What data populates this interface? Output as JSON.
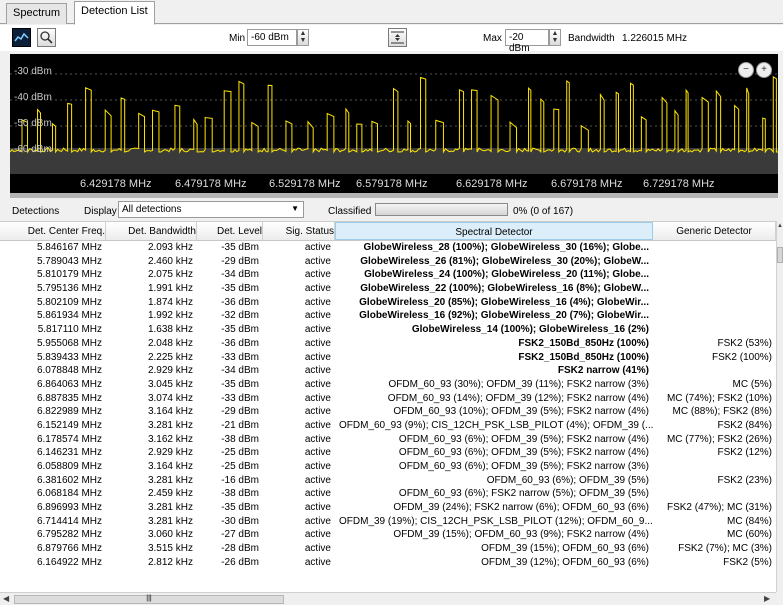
{
  "tabs": [
    {
      "label": "Spectrum",
      "active": false
    },
    {
      "label": "Detection List",
      "active": true
    }
  ],
  "toolbar": {
    "min_label": "Min",
    "min_value": "-60 dBm",
    "max_label": "Max",
    "max_value": "-20 dBm",
    "bandwidth_label": "Bandwidth",
    "bandwidth_value": "1.226015 MHz"
  },
  "spectrum": {
    "level_labels": [
      "-30 dBm",
      "-40 dBm",
      "-50 dBm",
      "-60 dBm"
    ],
    "freq_ticks": [
      "6.429178 MHz",
      "6.479178 MHz",
      "6.529178 MHz",
      "6.579178 MHz",
      "6.629178 MHz",
      "6.679178 MHz",
      "6.729178 MHz"
    ],
    "trace_color": "#ffe600",
    "background": "#000000"
  },
  "detections": {
    "label": "Detections",
    "display_label": "Display",
    "display_value": "All detections",
    "classified_label": "Classified",
    "classified_text": "0% (0 of 167)",
    "classified_fraction": 0
  },
  "table": {
    "columns": [
      "Det. Center Freq.",
      "Det. Bandwidth",
      "Det. Level",
      "Sig. Status",
      "Spectral Detector",
      "Generic Detector"
    ],
    "rows": [
      [
        "5.846167 MHz",
        "2.093 kHz",
        "-35 dBm",
        "active",
        "GlobeWireless_28 (100%); GlobeWireless_30 (16%); Globe...",
        "",
        true
      ],
      [
        "5.789043 MHz",
        "2.460 kHz",
        "-29 dBm",
        "active",
        "GlobeWireless_26 (81%); GlobeWireless_30 (20%); GlobeW...",
        "",
        true
      ],
      [
        "5.810179 MHz",
        "2.075 kHz",
        "-34 dBm",
        "active",
        "GlobeWireless_24 (100%); GlobeWireless_20 (11%); Globe...",
        "",
        true
      ],
      [
        "5.795136 MHz",
        "1.991 kHz",
        "-35 dBm",
        "active",
        "GlobeWireless_22 (100%); GlobeWireless_16 (8%); GlobeW...",
        "",
        true
      ],
      [
        "5.802109 MHz",
        "1.874 kHz",
        "-36 dBm",
        "active",
        "GlobeWireless_20 (85%); GlobeWireless_16 (4%); GlobeWir...",
        "",
        true
      ],
      [
        "5.861934 MHz",
        "1.992 kHz",
        "-32 dBm",
        "active",
        "GlobeWireless_16 (92%); GlobeWireless_20 (7%); GlobeWir...",
        "",
        true
      ],
      [
        "5.817110 MHz",
        "1.638 kHz",
        "-35 dBm",
        "active",
        "GlobeWireless_14 (100%); GlobeWireless_16 (2%)",
        "",
        true
      ],
      [
        "5.955068 MHz",
        "2.048 kHz",
        "-36 dBm",
        "active",
        "FSK2_150Bd_850Hz (100%)",
        "FSK2 (53%)",
        true
      ],
      [
        "5.839433 MHz",
        "2.225 kHz",
        "-33 dBm",
        "active",
        "FSK2_150Bd_850Hz (100%)",
        "FSK2 (100%)",
        true
      ],
      [
        "6.078848 MHz",
        "2.929 kHz",
        "-34 dBm",
        "active",
        "FSK2 narrow (41%)",
        "",
        true
      ],
      [
        "6.864063 MHz",
        "3.045 kHz",
        "-35 dBm",
        "active",
        "OFDM_60_93 (30%); OFDM_39 (11%); FSK2 narrow (3%)",
        "MC (5%)",
        false
      ],
      [
        "6.887835 MHz",
        "3.074 kHz",
        "-33 dBm",
        "active",
        "OFDM_60_93 (14%); OFDM_39 (12%); FSK2 narrow (4%)",
        "MC (74%); FSK2 (10%)",
        false
      ],
      [
        "6.822989 MHz",
        "3.164 kHz",
        "-29 dBm",
        "active",
        "OFDM_60_93 (10%); OFDM_39 (5%); FSK2 narrow (4%)",
        "MC (88%); FSK2 (8%)",
        false
      ],
      [
        "6.152149 MHz",
        "3.281 kHz",
        "-21 dBm",
        "active",
        "OFDM_60_93 (9%); CIS_12CH_PSK_LSB_PILOT (4%); OFDM_39 (...",
        "FSK2 (84%)",
        false
      ],
      [
        "6.178574 MHz",
        "3.162 kHz",
        "-38 dBm",
        "active",
        "OFDM_60_93 (6%); OFDM_39 (5%); FSK2 narrow (4%)",
        "MC (77%); FSK2 (26%)",
        false
      ],
      [
        "6.146231 MHz",
        "2.929 kHz",
        "-25 dBm",
        "active",
        "OFDM_60_93 (6%); OFDM_39 (5%); FSK2 narrow (4%)",
        "FSK2 (12%)",
        false
      ],
      [
        "6.058809 MHz",
        "3.164 kHz",
        "-25 dBm",
        "active",
        "OFDM_60_93 (6%); OFDM_39 (5%); FSK2 narrow (3%)",
        "",
        false
      ],
      [
        "6.381602 MHz",
        "3.281 kHz",
        "-16 dBm",
        "active",
        "OFDM_60_93 (6%); OFDM_39 (5%)",
        "FSK2 (23%)",
        false
      ],
      [
        "6.068184 MHz",
        "2.459 kHz",
        "-38 dBm",
        "active",
        "OFDM_60_93 (6%); FSK2 narrow (5%); OFDM_39 (5%)",
        "",
        false
      ],
      [
        "6.896993 MHz",
        "3.281 kHz",
        "-35 dBm",
        "active",
        "OFDM_39 (24%); FSK2 narrow (6%); OFDM_60_93 (6%)",
        "FSK2 (47%); MC (31%)",
        false
      ],
      [
        "6.714414 MHz",
        "3.281 kHz",
        "-30 dBm",
        "active",
        "OFDM_39 (19%); CIS_12CH_PSK_LSB_PILOT (12%); OFDM_60_9...",
        "MC (84%)",
        false
      ],
      [
        "6.795282 MHz",
        "3.060 kHz",
        "-27 dBm",
        "active",
        "OFDM_39 (15%); OFDM_60_93 (9%); FSK2 narrow (4%)",
        "MC (60%)",
        false
      ],
      [
        "6.879766 MHz",
        "3.515 kHz",
        "-28 dBm",
        "active",
        "OFDM_39 (15%); OFDM_60_93 (6%)",
        "FSK2 (7%); MC (3%)",
        false
      ],
      [
        "6.164922 MHz",
        "2.812 kHz",
        "-26 dBm",
        "active",
        "OFDM_39 (12%); OFDM_60_93 (6%)",
        "FSK2 (5%)",
        false
      ]
    ]
  }
}
